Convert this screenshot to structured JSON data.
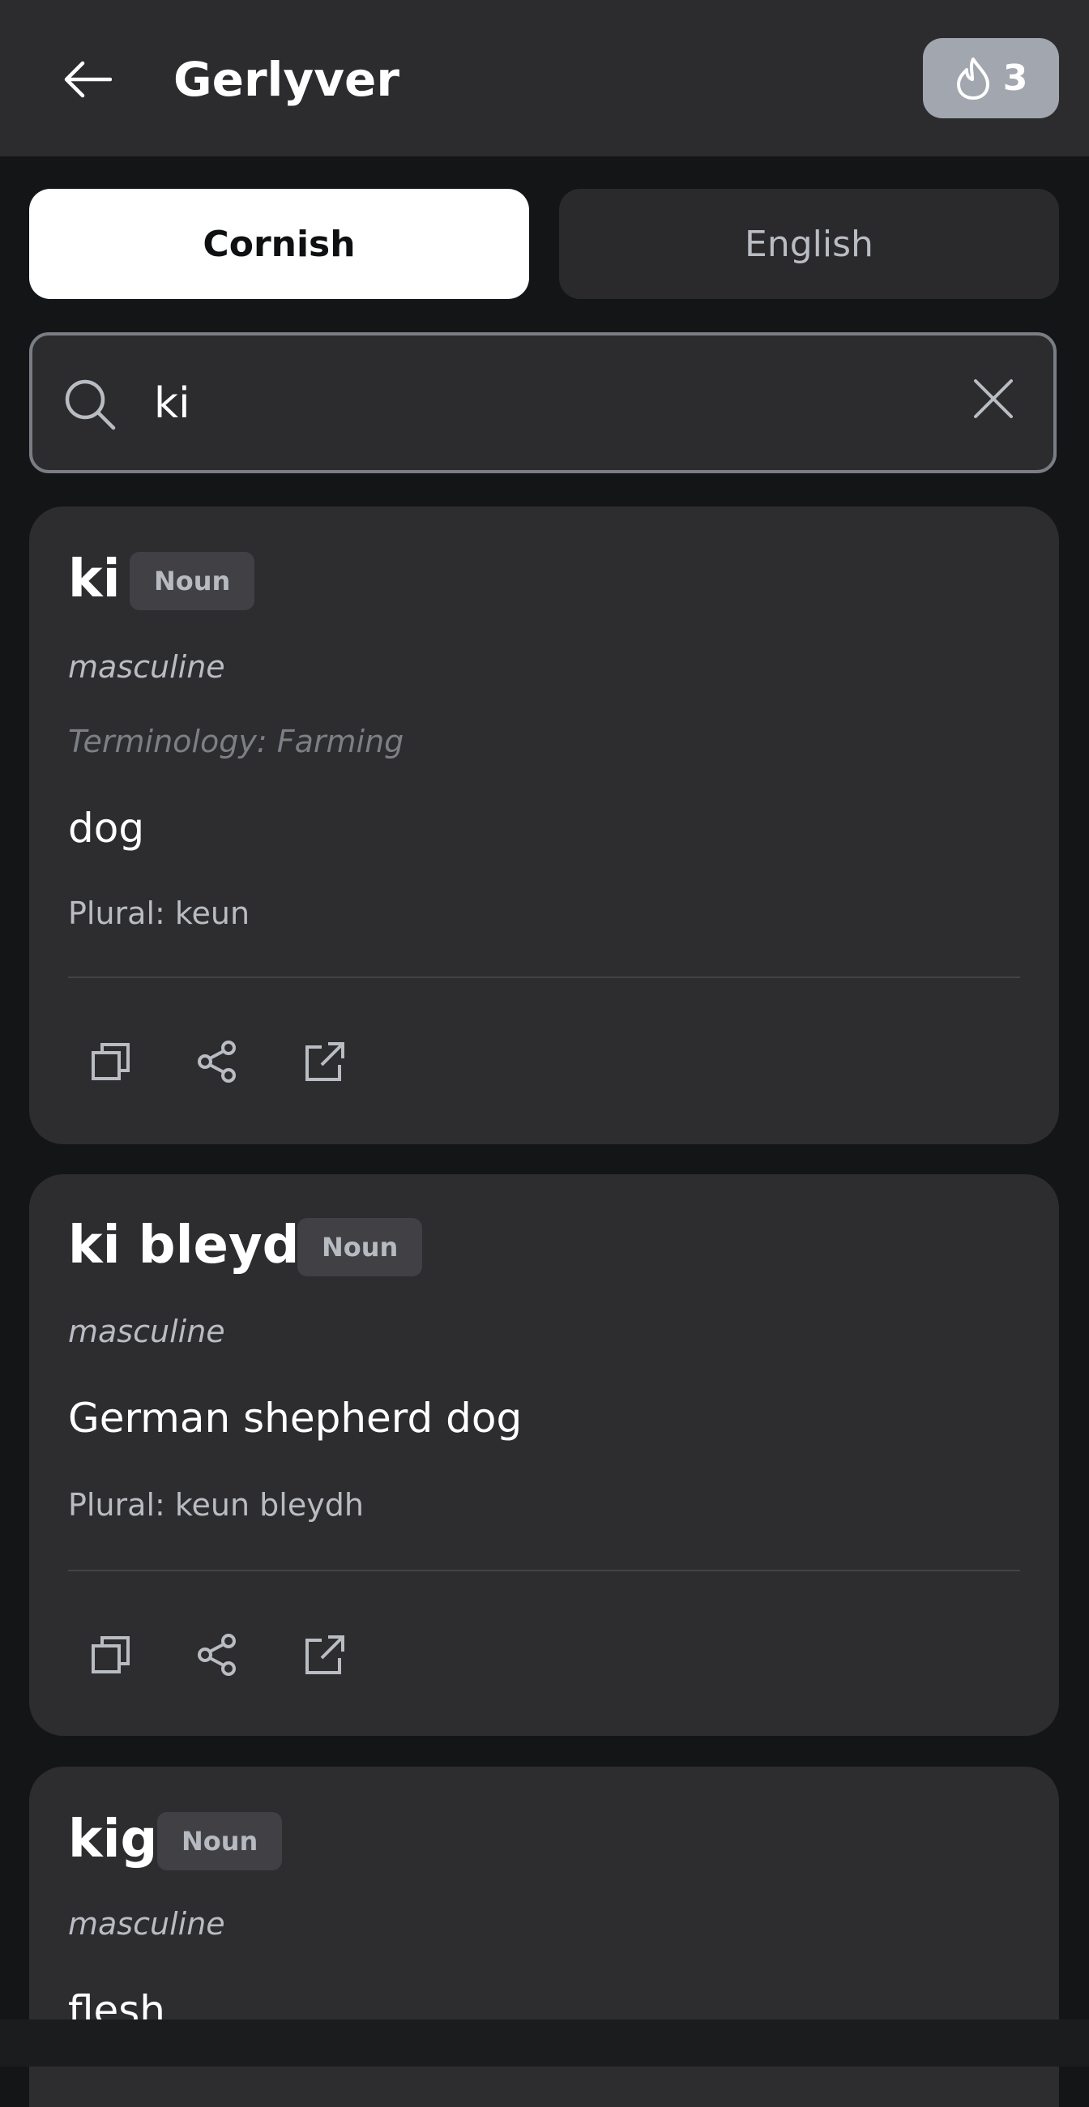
{
  "header": {
    "back_icon": "arrow-left-icon",
    "title": "Gerlyver",
    "streak": {
      "icon": "flame-icon",
      "count": "3"
    }
  },
  "language_tabs": [
    {
      "label": "Cornish",
      "selected": true
    },
    {
      "label": "English",
      "selected": false
    }
  ],
  "search": {
    "icon": "search-icon",
    "value": "ki",
    "clear_icon": "close-icon"
  },
  "results": [
    {
      "headword": "ki",
      "pos": "Noun",
      "gender": "masculine",
      "terminology": "Terminology: Farming",
      "translation": "dog",
      "plural": "Plural: keun",
      "actions": [
        "copy-icon",
        "share-icon",
        "open-external-icon"
      ]
    },
    {
      "headword": "ki bleydh",
      "pos": "Noun",
      "gender": "masculine",
      "translation": "German shepherd dog",
      "plural": "Plural: keun bleydh",
      "actions": [
        "copy-icon",
        "share-icon",
        "open-external-icon"
      ]
    },
    {
      "headword": "kig",
      "pos": "Noun",
      "gender": "masculine",
      "translation": "flesh"
    }
  ],
  "colors": {
    "background": "#141517",
    "surface": "#2d2d2f",
    "badge": "#a2a6ae",
    "selected_tab": "#ffffff"
  }
}
